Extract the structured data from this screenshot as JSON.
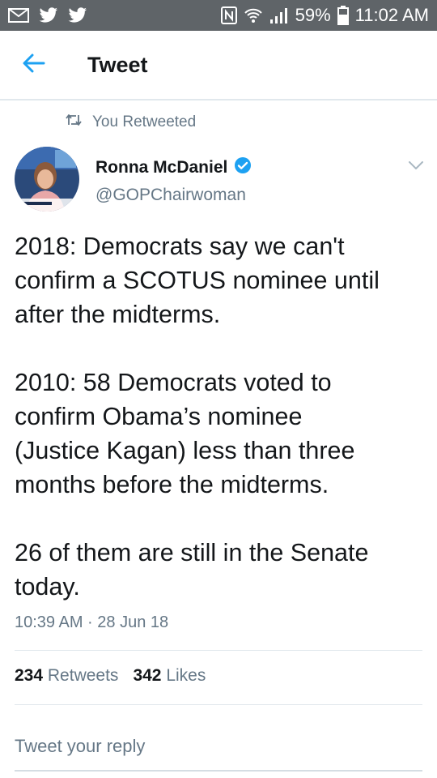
{
  "status_bar": {
    "battery": "59%",
    "time": "11:02 AM",
    "left_icons": [
      "mail-icon",
      "twitter-icon",
      "twitter-icon"
    ],
    "right_icons": [
      "nfc-icon",
      "wifi-icon",
      "signal-icon",
      "battery-icon"
    ]
  },
  "app_bar": {
    "title": "Tweet",
    "back_icon": "arrow-left-icon",
    "accent": "#1da1f2"
  },
  "retweet_context": {
    "label": "You Retweeted",
    "icon": "retweet-icon"
  },
  "author": {
    "name": "Ronna McDaniel",
    "handle": "@GOPChairwoman",
    "verified": true,
    "verified_color": "#1da1f2"
  },
  "tweet": {
    "lines": [
      "2018: Democrats say we can't",
      "confirm a SCOTUS nominee until",
      "after the midterms.",
      "",
      "2010: 58 Democrats voted to",
      "confirm Obama’s nominee",
      "(Justice Kagan) less than three",
      "months before the midterms.",
      "",
      "26 of them are still in the Senate",
      "today."
    ],
    "timestamp": "10:39 AM · 28 Jun 18"
  },
  "stats": {
    "retweets_count": "234",
    "retweets_label": "Retweets",
    "likes_count": "342",
    "likes_label": "Likes"
  },
  "reply": {
    "placeholder": "Tweet your reply"
  }
}
